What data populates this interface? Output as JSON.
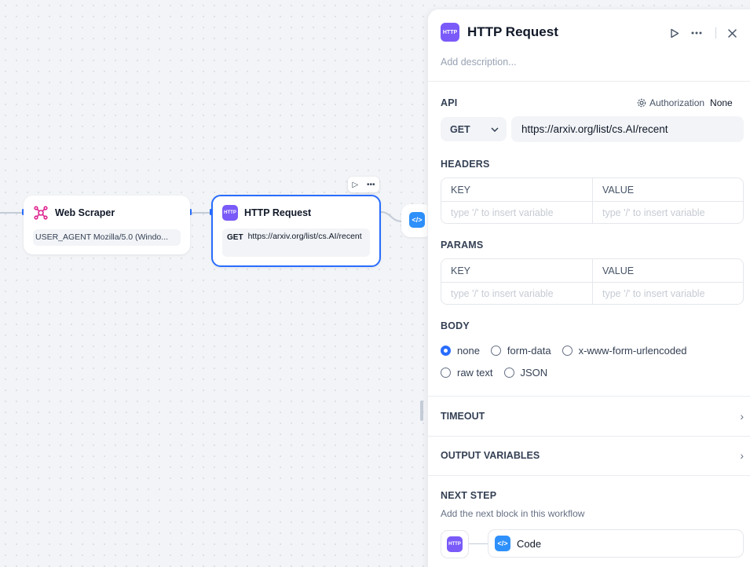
{
  "canvas": {
    "scraper_node": {
      "title": "Web Scraper",
      "body": "USER_AGENT Mozilla/5.0 (Windo..."
    },
    "http_node": {
      "title": "HTTP Request",
      "method": "GET",
      "url": "https://arxiv.org/list/cs.AI/recent"
    },
    "node_toolbar": {
      "run_icon": "play-icon",
      "more_icon": "more-icon"
    }
  },
  "panel": {
    "title": "HTTP Request",
    "description_placeholder": "Add description...",
    "api": {
      "label": "API",
      "auth_label": "Authorization",
      "auth_value": "None",
      "method": "GET",
      "url": "https://arxiv.org/list/cs.AI/recent"
    },
    "headers": {
      "label": "HEADERS",
      "key_header": "KEY",
      "value_header": "VALUE",
      "key_placeholder": "type '/' to insert variable",
      "value_placeholder": "type '/' to insert variable"
    },
    "params": {
      "label": "PARAMS",
      "key_header": "KEY",
      "value_header": "VALUE",
      "key_placeholder": "type '/' to insert variable",
      "value_placeholder": "type '/' to insert variable"
    },
    "body": {
      "label": "BODY",
      "options": [
        "none",
        "form-data",
        "x-www-form-urlencoded",
        "raw text",
        "JSON"
      ],
      "selected": "none"
    },
    "timeout_label": "TIMEOUT",
    "output_label": "OUTPUT VARIABLES",
    "next_step": {
      "label": "NEXT STEP",
      "description": "Add the next block in this workflow",
      "target": "Code"
    }
  },
  "icons": {
    "http": "HTTP",
    "code": "</>"
  },
  "colors": {
    "accent": "#296dff",
    "http_icon": "#7a5af8",
    "code_icon": "#2e90fa",
    "scraper_icon": "#dd2590"
  }
}
